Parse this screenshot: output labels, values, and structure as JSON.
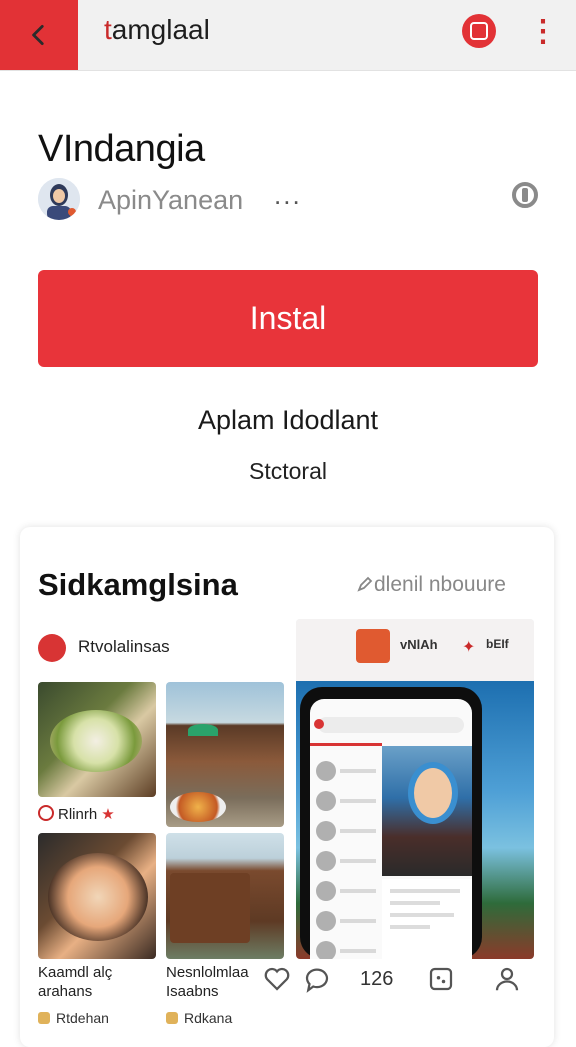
{
  "header": {
    "title_first": "t",
    "title_rest": "amglaal",
    "back_icon": "chevron-left-icon",
    "record_icon": "record-icon",
    "more_icon": "kebab-icon",
    "accent": "#e23236"
  },
  "app": {
    "name": "VIndangia",
    "developer": "ApinYanean",
    "developer_more": "...",
    "install_label": "Instal",
    "subtitle": "Aplam Idodlant",
    "secondary": "Stctoral"
  },
  "card": {
    "title": "Sidkamglsina",
    "link": "dlenil nbouure",
    "category": "Rtvolalinsas",
    "thumb_captions": {
      "t1": "Rlinrh",
      "t3_line1": "Kaamdl alç",
      "t3_line2": "arahans",
      "t4_line1": "Nesnlolmlaa",
      "t4_line2": "Isaabns"
    },
    "phone_preview": {
      "t1": "vNlAh",
      "t3": "bEIf"
    }
  },
  "nav": {
    "count": "126"
  },
  "bottom_peek": {
    "left": "Rtdehan",
    "right": "Rdkana"
  }
}
